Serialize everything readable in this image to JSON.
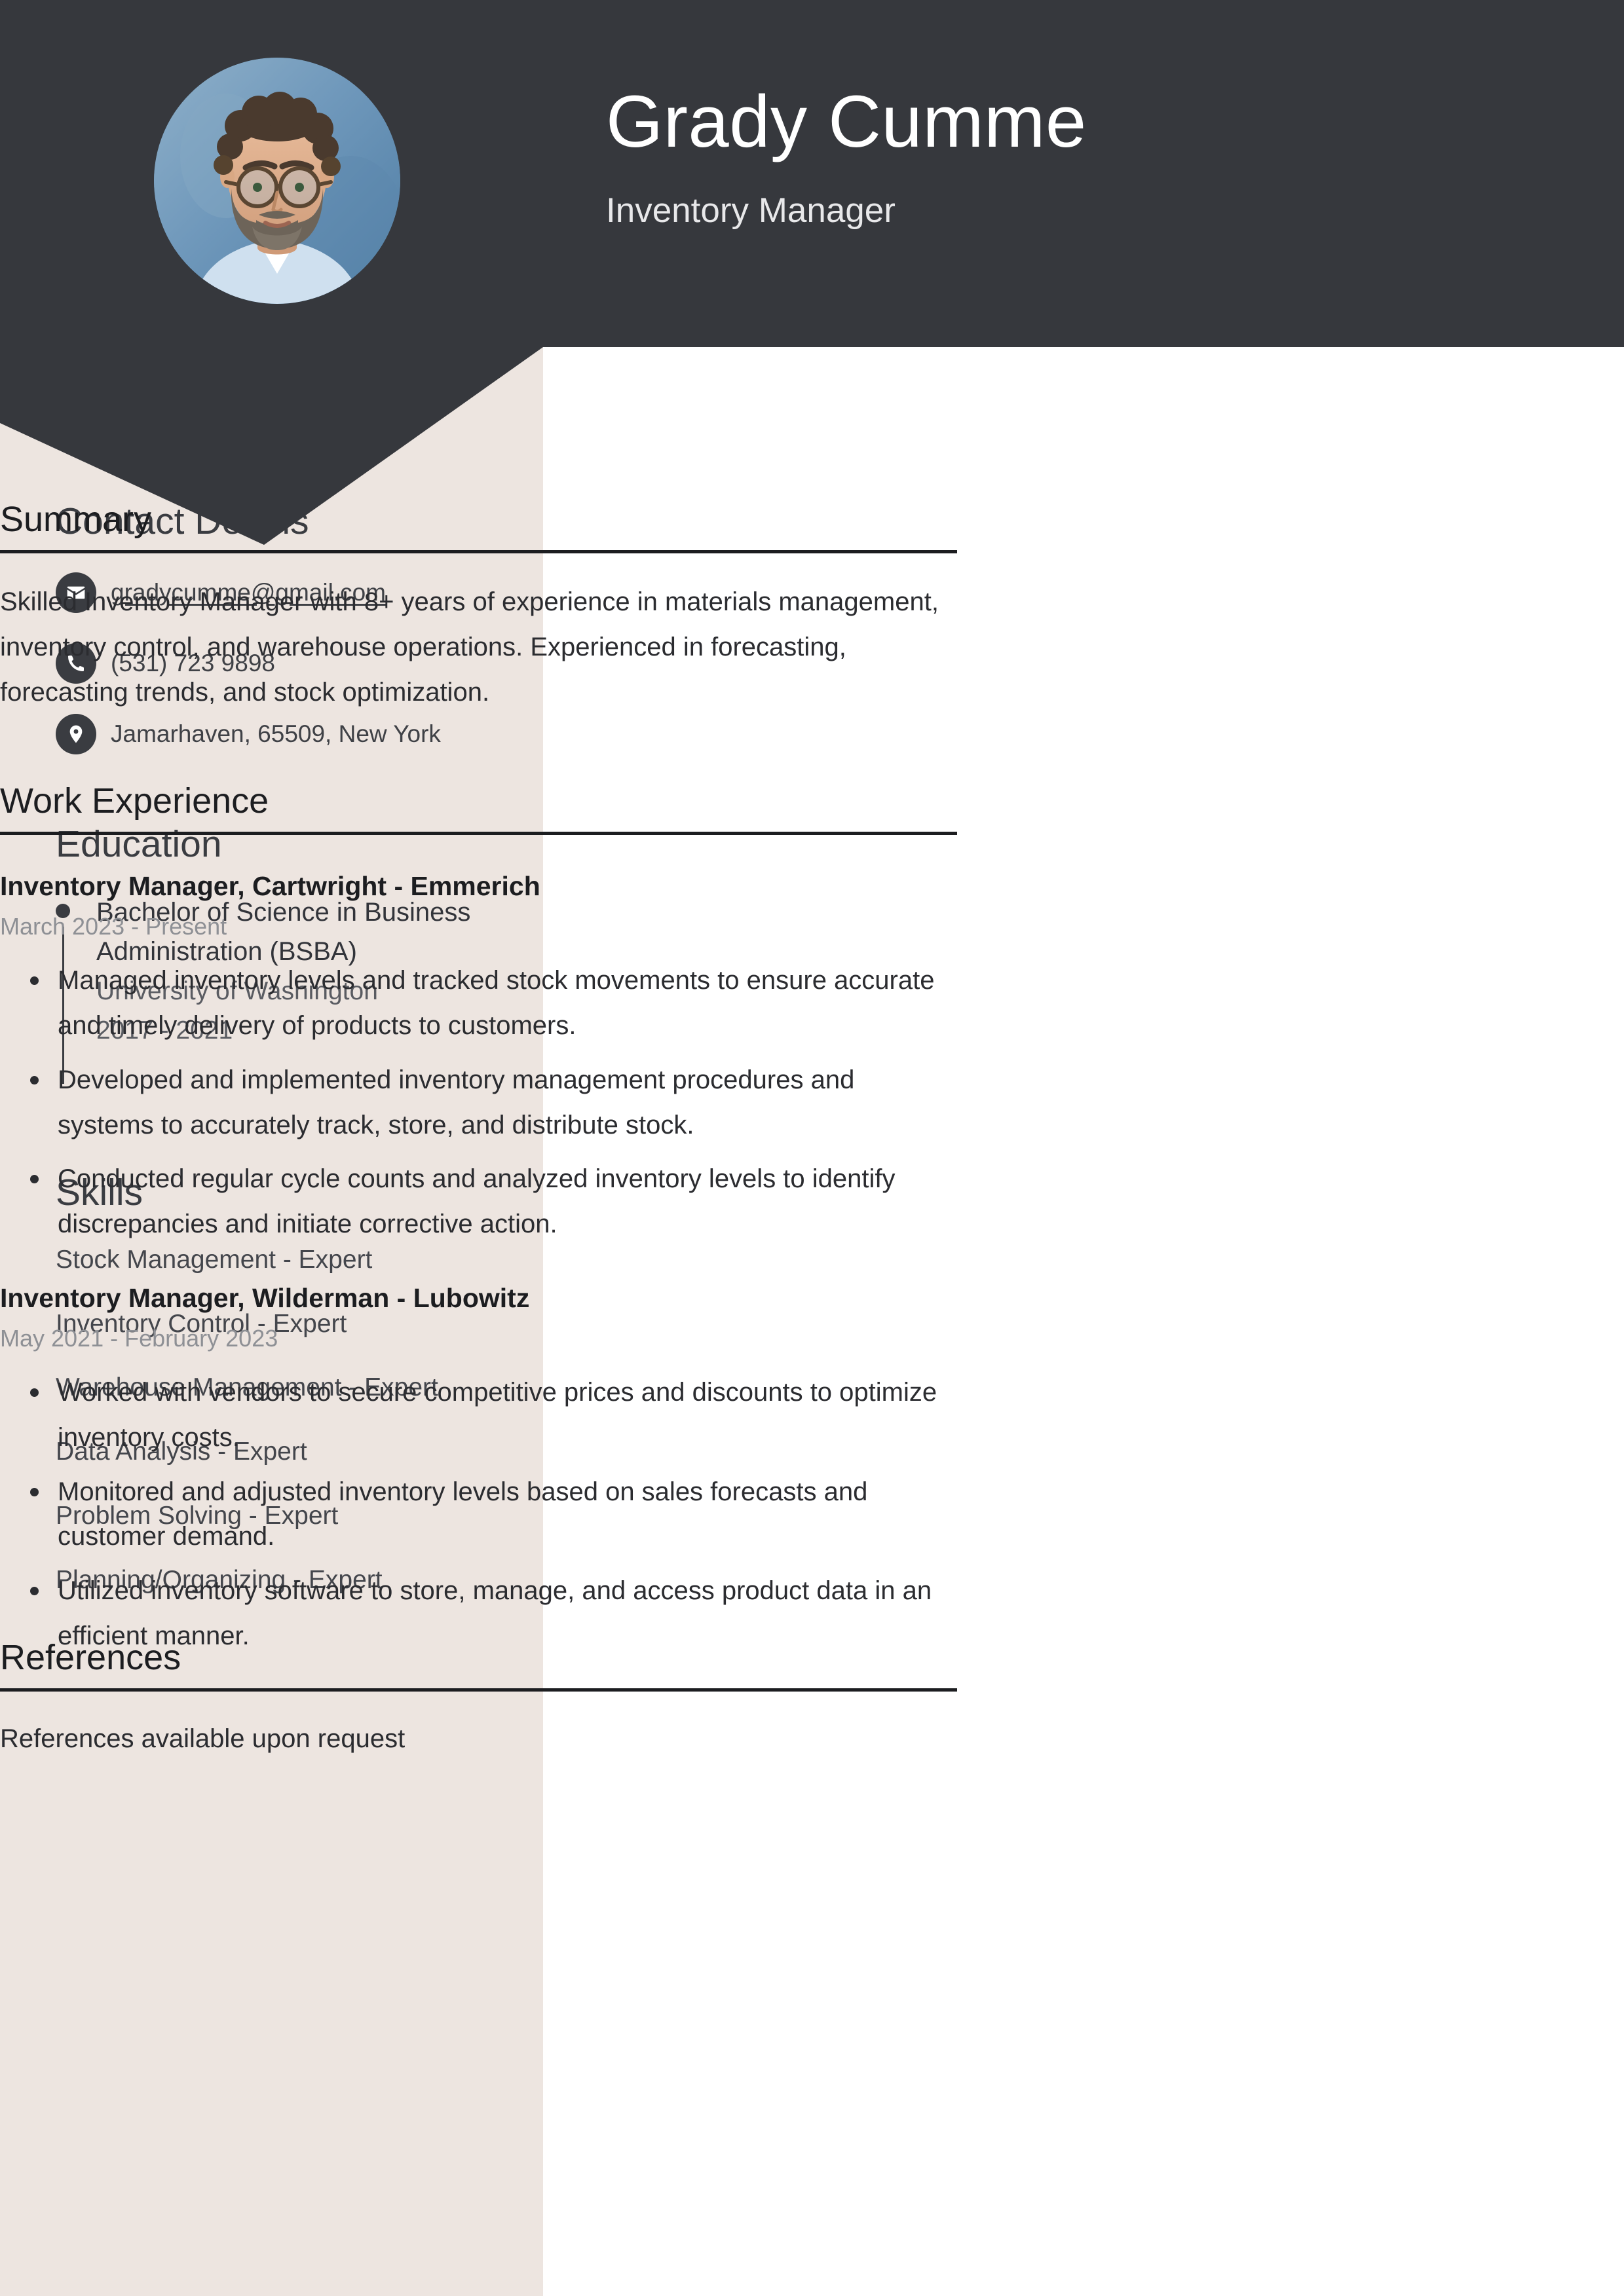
{
  "header": {
    "name": "Grady Cumme",
    "job_title": "Inventory Manager",
    "avatar_alt": "profile-photo",
    "bg_color": "#36383D"
  },
  "sidebar": {
    "bg_color": "#EDE5E0",
    "contact": {
      "heading": "Contact Details",
      "items": [
        {
          "icon": "envelope-icon",
          "value": "gradycumme@gmail.com",
          "is_link": true
        },
        {
          "icon": "phone-icon",
          "value": "(531) 723 9898",
          "is_link": false
        },
        {
          "icon": "map-pin-icon",
          "value": "Jamarhaven, 65509, New York",
          "is_link": false
        }
      ]
    },
    "education": {
      "heading": "Education",
      "items": [
        {
          "degree": "Bachelor of Science in Business Administration (BSBA)",
          "school": "University of Washington",
          "years": "2017 - 2021"
        }
      ]
    },
    "skills": {
      "heading": "Skills",
      "items": [
        "Stock Management - Expert",
        "Inventory Control - Expert",
        "Warehouse Management - Expert",
        "Data Analysis - Expert",
        "Problem Solving - Expert",
        "Planning/Organizing - Expert"
      ]
    }
  },
  "main": {
    "summary": {
      "heading": "Summary",
      "text": "Skilled Inventory Manager with 8+ years of experience in materials management, inventory control, and warehouse operations. Experienced in forecasting, forecasting trends, and stock optimization."
    },
    "work_experience": {
      "heading": "Work Experience",
      "jobs": [
        {
          "title": "Inventory Manager, Cartwright - Emmerich",
          "dates": "March 2023 - Present",
          "bullets": [
            "Managed inventory levels and tracked stock movements to ensure accurate and timely delivery of products to customers.",
            "Developed and implemented inventory management procedures and systems to accurately track, store, and distribute stock.",
            "Conducted regular cycle counts and analyzed inventory levels to identify discrepancies and initiate corrective action."
          ]
        },
        {
          "title": "Inventory Manager, Wilderman - Lubowitz",
          "dates": "May 2021 - February 2023",
          "bullets": [
            "Worked with vendors to secure competitive prices and discounts to optimize inventory costs.",
            "Monitored and adjusted inventory levels based on sales forecasts and customer demand.",
            "Utilized inventory software to store, manage, and access product data in an efficient manner."
          ]
        }
      ]
    },
    "references": {
      "heading": "References",
      "text": "References available upon request"
    }
  }
}
